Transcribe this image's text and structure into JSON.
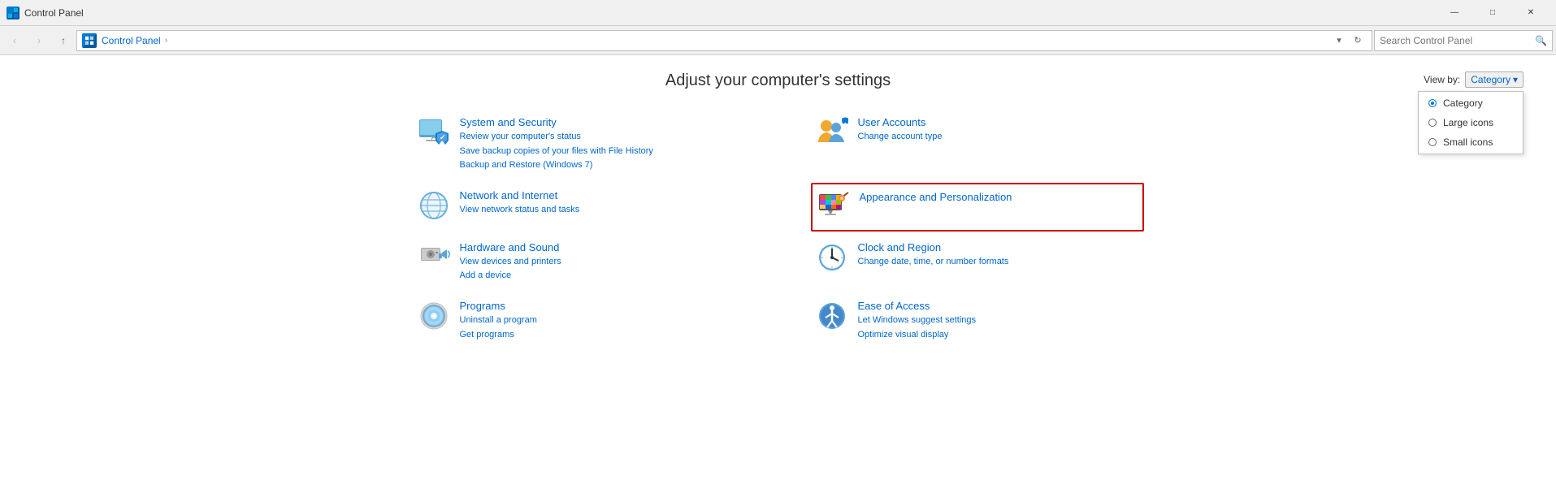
{
  "window": {
    "title": "Control Panel",
    "icon_label": "CP"
  },
  "titlebar": {
    "minimize": "—",
    "maximize": "□",
    "close": "✕"
  },
  "navbar": {
    "back": "‹",
    "forward": "›",
    "up": "↑",
    "address_icon": "CP",
    "breadcrumb": [
      "Control Panel"
    ],
    "separator": "›",
    "refresh": "↻",
    "dropdown_arrow": "▾",
    "search_placeholder": "Search Control Panel",
    "search_icon": "🔍"
  },
  "main": {
    "page_title": "Adjust your computer's settings",
    "view_by_label": "View by:",
    "view_by_value": "Category",
    "view_by_arrow": "▾"
  },
  "dropdown": {
    "items": [
      {
        "label": "Category",
        "selected": true
      },
      {
        "label": "Large icons",
        "selected": false
      },
      {
        "label": "Small icons",
        "selected": false
      }
    ]
  },
  "categories": [
    {
      "id": "system-security",
      "title": "System and Security",
      "links": [
        "Review your computer's status",
        "Save backup copies of your files with File History",
        "Backup and Restore (Windows 7)"
      ],
      "highlighted": false
    },
    {
      "id": "user-accounts",
      "title": "User Accounts",
      "links": [
        "Change account type"
      ],
      "highlighted": false
    },
    {
      "id": "network-internet",
      "title": "Network and Internet",
      "links": [
        "View network status and tasks"
      ],
      "highlighted": false
    },
    {
      "id": "appearance-personalization",
      "title": "Appearance and Personalization",
      "links": [],
      "highlighted": true
    },
    {
      "id": "hardware-sound",
      "title": "Hardware and Sound",
      "links": [
        "View devices and printers",
        "Add a device"
      ],
      "highlighted": false
    },
    {
      "id": "clock-region",
      "title": "Clock and Region",
      "links": [
        "Change date, time, or number formats"
      ],
      "highlighted": false
    },
    {
      "id": "programs",
      "title": "Programs",
      "links": [
        "Uninstall a program",
        "Get programs"
      ],
      "highlighted": false
    },
    {
      "id": "ease-of-access",
      "title": "Ease of Access",
      "links": [
        "Let Windows suggest settings",
        "Optimize visual display"
      ],
      "highlighted": false
    }
  ]
}
